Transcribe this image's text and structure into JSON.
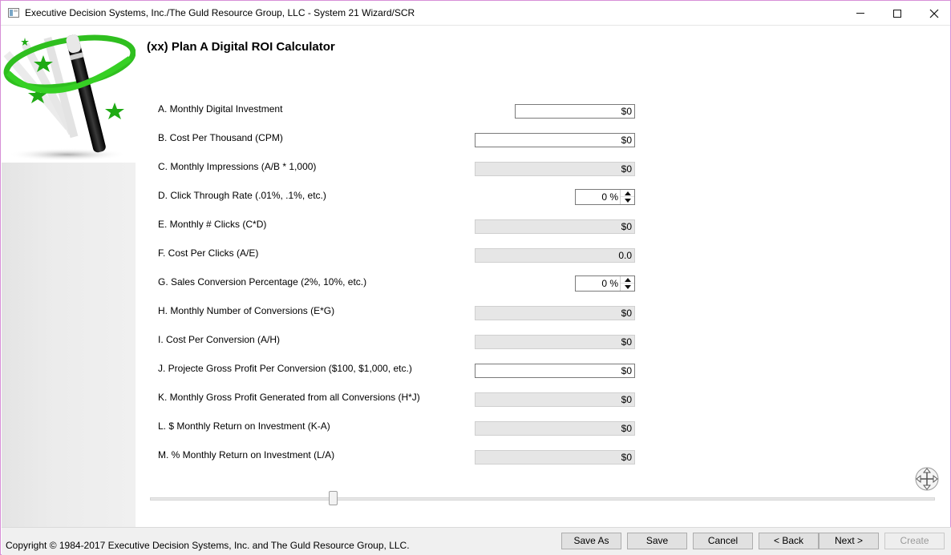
{
  "window": {
    "title": "Executive Decision Systems, Inc./The Guld Resource Group, LLC - System 21 Wizard/SCR"
  },
  "page": {
    "heading": "(xx) Plan A Digital ROI Calculator"
  },
  "rows": [
    {
      "label": "A. Monthly Digital Investment",
      "value": "$0",
      "kind": "input"
    },
    {
      "label": "B. Cost Per Thousand (CPM)",
      "value": "$0",
      "kind": "input"
    },
    {
      "label": "C. Monthly Impressions (A/B * 1,000)",
      "value": "$0",
      "kind": "readonly"
    },
    {
      "label": "D. Click Through Rate (.01%, .1%, etc.)",
      "value": "0 %",
      "kind": "spinner"
    },
    {
      "label": "E. Monthly # Clicks (C*D)",
      "value": "$0",
      "kind": "readonly"
    },
    {
      "label": "F. Cost Per Clicks (A/E)",
      "value": "0.0",
      "kind": "readonly"
    },
    {
      "label": "G. Sales Conversion Percentage (2%, 10%, etc.)",
      "value": "0 %",
      "kind": "spinner"
    },
    {
      "label": "H. Monthly Number of Conversions (E*G)",
      "value": "$0",
      "kind": "readonly"
    },
    {
      "label": "I. Cost Per Conversion (A/H)",
      "value": "$0",
      "kind": "readonly"
    },
    {
      "label": "J. Projecte Gross Profit Per Conversion ($100, $1,000, etc.)",
      "value": "$0",
      "kind": "input"
    },
    {
      "label": "K. Monthly Gross Profit Generated from all Conversions (H*J)",
      "value": "$0",
      "kind": "readonly"
    },
    {
      "label": "L. $ Monthly Return on Investment (K-A)",
      "value": "$0",
      "kind": "readonly"
    },
    {
      "label": "M. % Monthly Return on Investment (L/A)",
      "value": "$0",
      "kind": "readonly"
    }
  ],
  "slider": {
    "position_fraction": 0.23
  },
  "footer": {
    "copyright": "Copyright © 1984-2017 Executive Decision Systems, Inc. and The Guld Resource Group, LLC.",
    "buttons": {
      "save_as": "Save As",
      "save": "Save",
      "cancel": "Cancel",
      "back": "< Back",
      "next": "Next >",
      "create": "Create"
    }
  },
  "icons": {
    "logo": "magic-wand-icon",
    "move": "move-arrows-icon"
  }
}
